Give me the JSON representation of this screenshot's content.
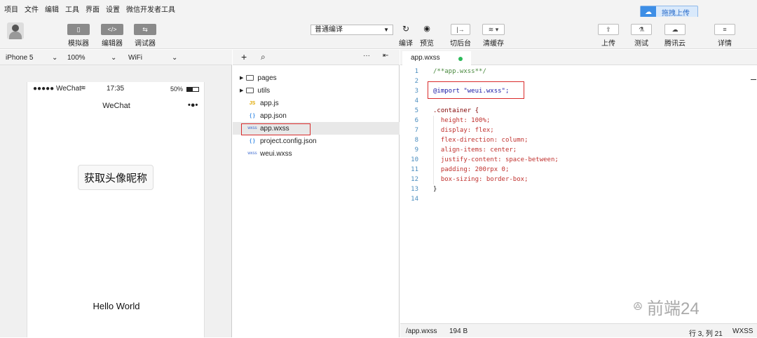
{
  "menu": [
    "项目",
    "文件",
    "编辑",
    "工具",
    "界面",
    "设置",
    "微信开发者工具"
  ],
  "toolbar": {
    "simulator": "模拟器",
    "editor": "编辑器",
    "debugger": "调试器",
    "compile_mode": "普通编译",
    "compile": "编译",
    "preview": "预览",
    "background": "切后台",
    "clear_cache": "清缓存",
    "upload": "上传",
    "test": "测试",
    "tencent_cloud": "腾讯云",
    "details": "详情",
    "drag_upload": "拖拽上传"
  },
  "simulator": {
    "device": "iPhone 5",
    "zoom": "100%",
    "network": "WiFi",
    "status_carrier": "●●●●● WeChat",
    "status_time": "17:35",
    "status_battery": "50%",
    "nav_title": "WeChat",
    "nav_dots": "•●•",
    "button_label": "获取头像昵称",
    "hello": "Hello World"
  },
  "file_tree": {
    "items": [
      {
        "icon": "folder",
        "label": "pages"
      },
      {
        "icon": "folder",
        "label": "utils"
      },
      {
        "icon": "JS",
        "label": "app.js"
      },
      {
        "icon": "{ }",
        "label": "app.json"
      },
      {
        "icon": "wxss",
        "label": "app.wxss"
      },
      {
        "icon": "{ }",
        "label": "project.config.json"
      },
      {
        "icon": "wxss",
        "label": "weui.wxss"
      }
    ]
  },
  "editor": {
    "tab": "app.wxss",
    "lines": [
      {
        "n": "1",
        "code": "/**app.wxss**/"
      },
      {
        "n": "2",
        "code": ""
      },
      {
        "n": "3",
        "code": "@import \"weui.wxss\";"
      },
      {
        "n": "4",
        "code": ""
      },
      {
        "n": "5",
        "code": ".container {"
      },
      {
        "n": "6",
        "code": "  height: 100%;"
      },
      {
        "n": "7",
        "code": "  display: flex;"
      },
      {
        "n": "8",
        "code": "  flex-direction: column;"
      },
      {
        "n": "9",
        "code": "  align-items: center;"
      },
      {
        "n": "10",
        "code": "  justify-content: space-between;"
      },
      {
        "n": "11",
        "code": "  padding: 200rpx 0;"
      },
      {
        "n": "12",
        "code": "  box-sizing: border-box;"
      },
      {
        "n": "13",
        "code": "}"
      },
      {
        "n": "14",
        "code": ""
      }
    ]
  },
  "statusbar": {
    "path": "/app.wxss",
    "size": "194 B",
    "position": "行 3, 列 21",
    "lang": "WXSS"
  },
  "watermark": "前端24",
  "colors": {
    "accent": "#3d8ee6",
    "highlight_box": "#d92b2b",
    "modified_dot": "#2cba5a"
  }
}
